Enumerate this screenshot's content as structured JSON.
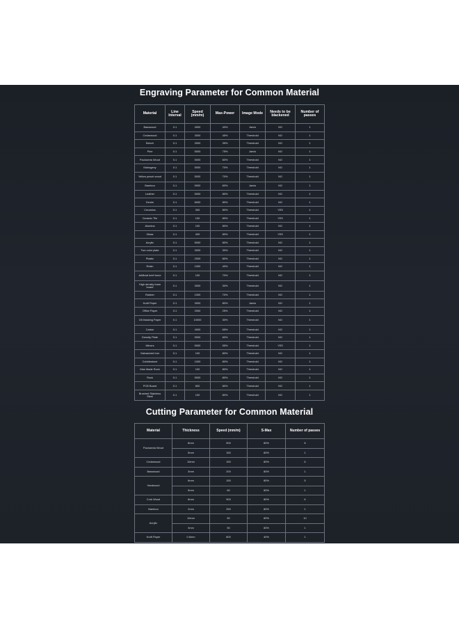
{
  "engraving": {
    "title": "Engraving Parameter for Common Material",
    "headers": [
      "Material",
      "Line Interval",
      "Speed (mm/m)",
      "Max-Power",
      "Image Mode",
      "Needs to be blackened",
      "Number of passes"
    ],
    "rows": [
      [
        "Basswood",
        "0.1",
        "4000",
        "40%",
        "Jarvis",
        "NO",
        "1"
      ],
      [
        "Cedarwood",
        "0.1",
        "3000",
        "45%",
        "Threshold",
        "NO",
        "1"
      ],
      [
        "Beech",
        "0.1",
        "3000",
        "35%",
        "Threshold",
        "NO",
        "1"
      ],
      [
        "Pine",
        "0.1",
        "5000",
        "75%",
        "Jarvis",
        "NO",
        "1"
      ],
      [
        "Paulownia Wood",
        "0.1",
        "5000",
        "60%",
        "Threshold",
        "NO",
        "1"
      ],
      [
        "Mahogany",
        "0.1",
        "5000",
        "70%",
        "Threshold",
        "NO",
        "1"
      ],
      [
        "Yellow peach wood",
        "0.1",
        "5000",
        "70%",
        "Threshold",
        "NO",
        "1"
      ],
      [
        "Bamboo",
        "0.1",
        "5000",
        "60%",
        "Jarvis",
        "NO",
        "1"
      ],
      [
        "Leather",
        "0.1",
        "5000",
        "80%",
        "Threshold",
        "NO",
        "1"
      ],
      [
        "Denim",
        "0.1",
        "6000",
        "80%",
        "Threshold",
        "NO",
        "1"
      ],
      [
        "Ceramics",
        "0.1",
        "300",
        "80%",
        "Threshold",
        "YES",
        "1"
      ],
      [
        "Ceramic Tile",
        "0.1",
        "100",
        "80%",
        "Threshold",
        "YES",
        "1"
      ],
      [
        "Alumina",
        "0.1",
        "100",
        "80%",
        "Threshold",
        "NO",
        "1"
      ],
      [
        "Glass",
        "0.1",
        "400",
        "80%",
        "Threshold",
        "YES",
        "1"
      ],
      [
        "Acrylic",
        "0.1",
        "5000",
        "80%",
        "Threshold",
        "NO",
        "1"
      ],
      [
        "Two color plate",
        "0.1",
        "3000",
        "30%",
        "Threshold",
        "NO",
        "1"
      ],
      [
        "Plastic",
        "0.1",
        "2000",
        "80%",
        "Threshold",
        "NO",
        "1"
      ],
      [
        "Resin",
        "0.1",
        "1000",
        "40%",
        "Threshold",
        "NO",
        "1"
      ],
      [
        "Artificial beef bone",
        "0.1",
        "100",
        "70%",
        "Threshold",
        "NO",
        "1"
      ],
      [
        "High density foam board",
        "0.1",
        "3000",
        "30%",
        "Threshold",
        "NO",
        "1"
      ],
      [
        "Rubber",
        "0.1",
        "1000",
        "70%",
        "Threshold",
        "NO",
        "1"
      ],
      [
        "Kraft Paper",
        "0.1",
        "3000",
        "80%",
        "Jarvis",
        "NO",
        "1"
      ],
      [
        "Office Paper",
        "0.1",
        "2000",
        "25%",
        "Threshold",
        "NO",
        "1"
      ],
      [
        "Oil Masking Paper",
        "0.1",
        "10000",
        "30%",
        "Threshold",
        "NO",
        "1"
      ],
      [
        "Carton",
        "0.1",
        "4000",
        "65%",
        "Threshold",
        "NO",
        "1"
      ],
      [
        "Density Plate",
        "0.1",
        "5000",
        "60%",
        "Threshold",
        "NO",
        "1"
      ],
      [
        "Mirrors",
        "0.1",
        "5000",
        "55%",
        "Threshold",
        "YES",
        "1"
      ],
      [
        "Galvanized Iron",
        "0.1",
        "100",
        "80%",
        "Threshold",
        "NO",
        "1"
      ],
      [
        "Cobblestone",
        "0.1",
        "1000",
        "80%",
        "Threshold",
        "NO",
        "1"
      ],
      [
        "Man Made Rock",
        "0.1",
        "100",
        "80%",
        "Threshold",
        "NO",
        "1"
      ],
      [
        "Rock",
        "0.1",
        "5000",
        "80%",
        "Threshold",
        "NO",
        "1"
      ],
      [
        "PCB Board",
        "0.1",
        "600",
        "80%",
        "Threshold",
        "NO",
        "1"
      ],
      [
        "Brushed Stainless Steel",
        "0.1",
        "100",
        "80%",
        "Threshold",
        "NO",
        "1"
      ]
    ]
  },
  "cutting": {
    "title": "Cutting Parameter for Common Material",
    "headers": [
      "Material",
      "Thickness",
      "Speed (mm/m)",
      "S-Max",
      "Number of passes"
    ],
    "rows": [
      {
        "material": "Paulownia Wood",
        "span": 2,
        "thickness": "8mm",
        "speed": "500",
        "smax": "80%",
        "passes": "8"
      },
      {
        "thickness": "5mm",
        "speed": "150",
        "smax": "80%",
        "passes": "1"
      },
      {
        "material": "Cedarwood",
        "span": 1,
        "thickness": "10mm",
        "speed": "150",
        "smax": "80%",
        "passes": "6"
      },
      {
        "material": "Basswood",
        "span": 1,
        "thickness": "3mm",
        "speed": "200",
        "smax": "80%",
        "passes": "1"
      },
      {
        "material": "Hardwood",
        "span": 2,
        "thickness": "6mm",
        "speed": "150",
        "smax": "80%",
        "passes": "5"
      },
      {
        "thickness": "5mm",
        "speed": "60",
        "smax": "80%",
        "passes": "1"
      },
      {
        "material": "Cork Wood",
        "span": 1,
        "thickness": "8mm",
        "speed": "900",
        "smax": "80%",
        "passes": "6"
      },
      {
        "material": "Bamboo",
        "span": 1,
        "thickness": "2mm",
        "speed": "250",
        "smax": "80%",
        "passes": "1"
      },
      {
        "material": "Acrylic",
        "span": 2,
        "thickness": "10mm",
        "speed": "50",
        "smax": "80%",
        "passes": "10"
      },
      {
        "thickness": "3mm",
        "speed": "50",
        "smax": "80%",
        "passes": "1"
      },
      {
        "material": "Kraft Paper",
        "span": 1,
        "thickness": "0.6mm",
        "speed": "800",
        "smax": "40%",
        "passes": "1"
      }
    ]
  },
  "colors": {
    "panel": "#1d2128",
    "border": "#6b727c",
    "text": "#ffffff"
  }
}
